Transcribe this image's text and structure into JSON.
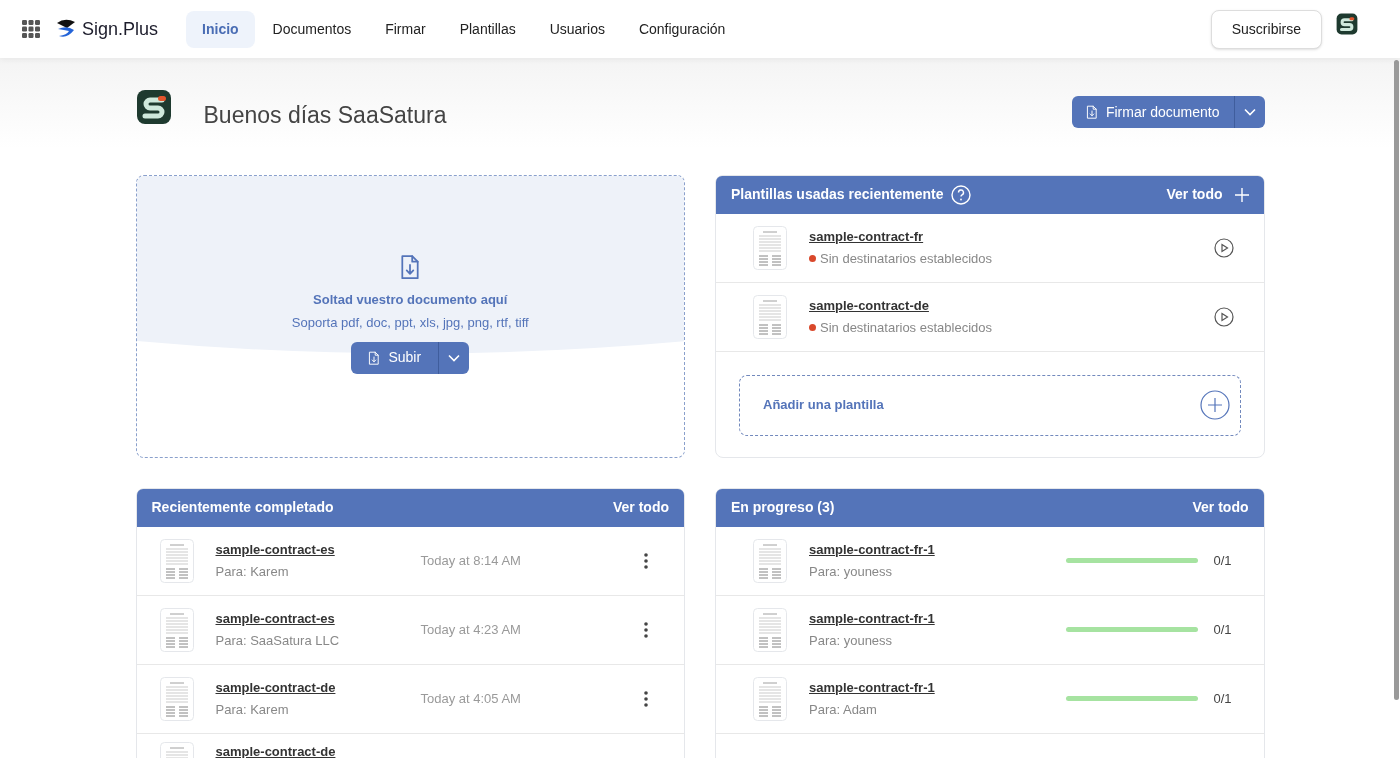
{
  "brand": {
    "name": "Sign.Plus"
  },
  "nav": [
    {
      "label": "Inicio",
      "selected": true
    },
    {
      "label": "Documentos",
      "selected": false
    },
    {
      "label": "Firmar",
      "selected": false
    },
    {
      "label": "Plantillas",
      "selected": false
    },
    {
      "label": "Usuarios",
      "selected": false
    },
    {
      "label": "Configuración",
      "selected": false
    }
  ],
  "subscribe_button": "Suscribirse",
  "greeting": "Buenos días SaaSatura",
  "sign_button": "Firmar documento",
  "upload": {
    "title": "Soltad vuestro documento aquí",
    "subtitle": "Soporta pdf, doc, ppt, xls, jpg, png, rtf, tiff",
    "button": "Subir"
  },
  "templates": {
    "title": "Plantillas usadas recientemente",
    "view_all": "Ver todo",
    "items": [
      {
        "name": "sample-contract-fr",
        "status": "Sin destinatarios establecidos",
        "color": "#d9482b"
      },
      {
        "name": "sample-contract-de",
        "status": "Sin destinatarios establecidos",
        "color": "#d9482b"
      }
    ],
    "add": "Añadir una plantilla"
  },
  "completed": {
    "title": "Recientemente completado",
    "view_all": "Ver todo",
    "rows": [
      {
        "name": "sample-contract-es",
        "recipient": "Para: Karem",
        "time": "Today at 8:14 AM"
      },
      {
        "name": "sample-contract-es",
        "recipient": "Para: SaaSatura LLC",
        "time": "Today at 4:23 AM"
      },
      {
        "name": "sample-contract-de",
        "recipient": "Para: Karem",
        "time": "Today at 4:05 AM"
      },
      {
        "name": "sample-contract-de"
      }
    ]
  },
  "in_progress": {
    "title": "En progreso (3)",
    "view_all": "Ver todo",
    "rows": [
      {
        "name": "sample-contract-fr-1",
        "recipient": "Para: youness",
        "level": 0,
        "count": "0/1"
      },
      {
        "name": "sample-contract-fr-1",
        "recipient": "Para: youness",
        "level": 0,
        "count": "0/1"
      },
      {
        "name": "sample-contract-fr-1",
        "recipient": "Para: Adam",
        "level": 0,
        "count": "0/1"
      }
    ]
  }
}
